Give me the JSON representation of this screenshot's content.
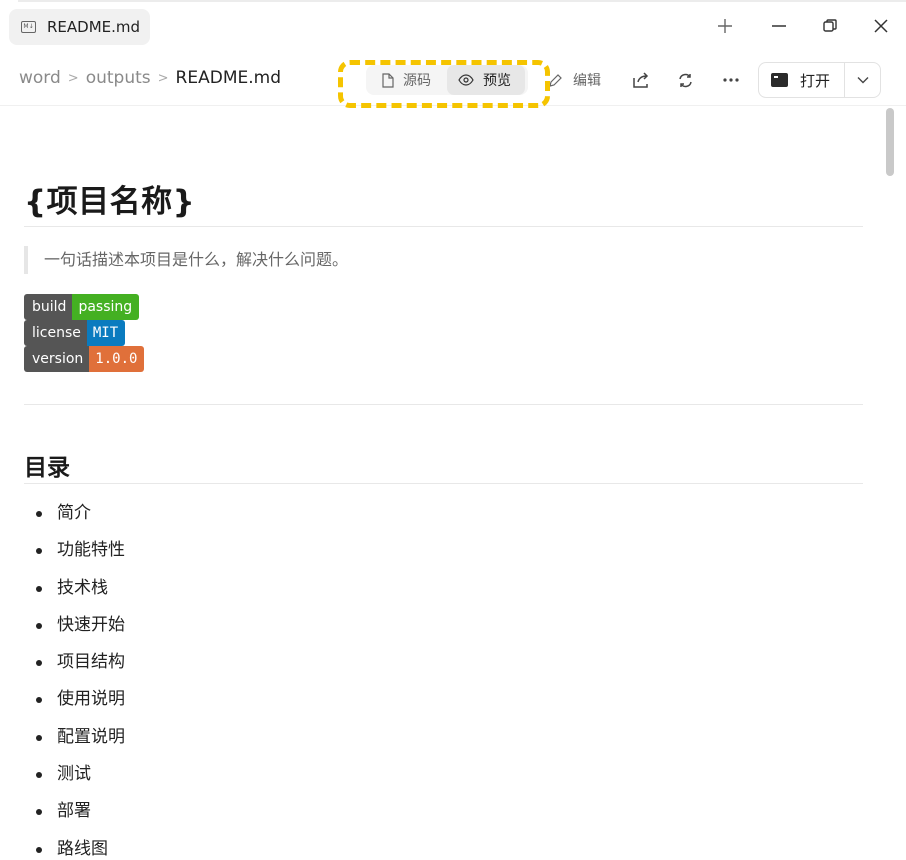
{
  "window": {
    "tab_title": "README.md",
    "tab_icon_text": "M↓"
  },
  "toolbar": {
    "breadcrumb": [
      "word",
      "outputs",
      "README.md"
    ],
    "view_source_label": "源码",
    "view_preview_label": "预览",
    "active_view": "预览",
    "edit_label": "编辑",
    "open_label": "打开",
    "highlight_color": "#f5c400"
  },
  "document": {
    "title": "{项目名称}",
    "quote": "一句话描述本项目是什么，解决什么问题。",
    "badges": [
      {
        "key": "build",
        "value": "passing",
        "color": "#44b022"
      },
      {
        "key": "license",
        "value": "MIT",
        "color": "#0a7bbf"
      },
      {
        "key": "version",
        "value": "1.0.0",
        "color": "#e0703a"
      }
    ],
    "toc_heading": "目录",
    "toc_items": [
      "简介",
      "功能特性",
      "技术栈",
      "快速开始",
      "项目结构",
      "使用说明",
      "配置说明",
      "测试",
      "部署",
      "路线图"
    ]
  }
}
